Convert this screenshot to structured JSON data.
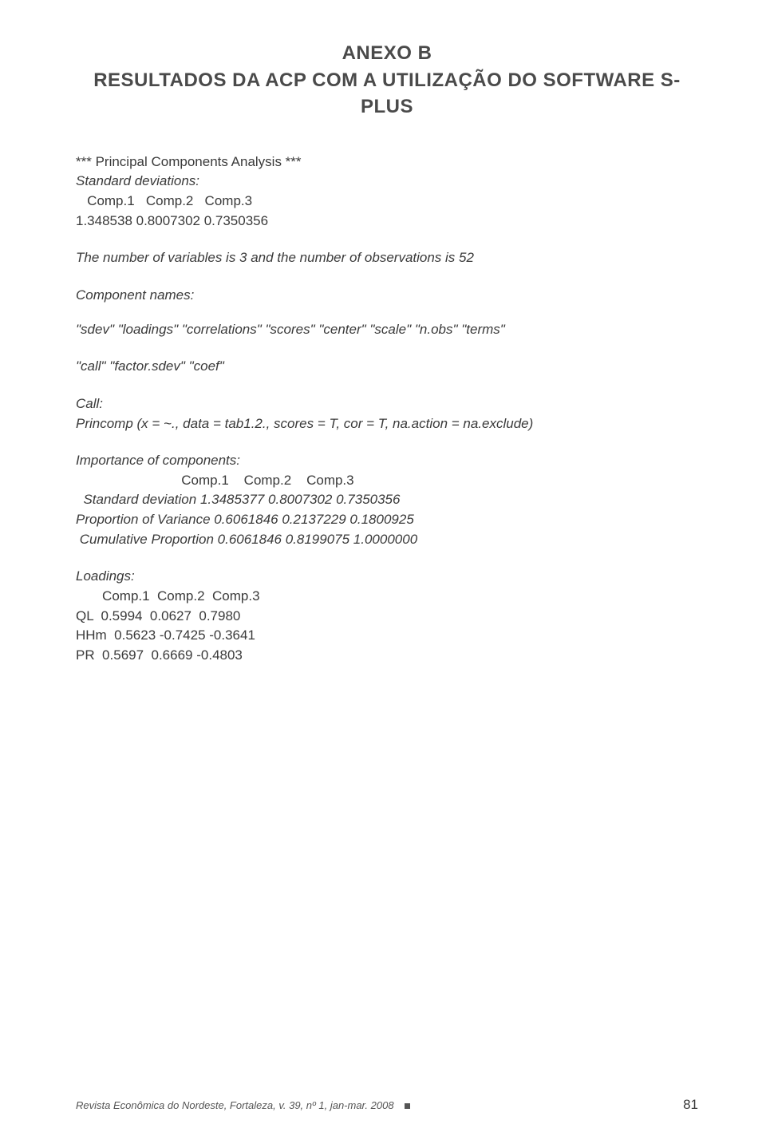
{
  "title": {
    "line1": "ANEXO B",
    "line2": "RESULTADOS DA ACP COM A UTILIZAÇÃO DO SOFTWARE S-PLUS"
  },
  "body": {
    "pca_header": "*** Principal Components Analysis ***",
    "std_dev_label": "Standard deviations:",
    "std_dev_cols": "   Comp.1   Comp.2   Comp.3",
    "std_dev_vals": "1.348538 0.8007302 0.7350356",
    "num_vars": "The number of variables is 3 and the number of observations is 52",
    "comp_names_label": "Component names:",
    "comp_names": "\"sdev\" \"loadings\" \"correlations\" \"scores\" \"center\" \"scale\" \"n.obs\" \"terms\"",
    "comp_names2": "\"call\" \"factor.sdev\" \"coef\"",
    "call_label": "Call:",
    "call_line": "Princomp (x =  ~., data = tab1.2., scores = T, cor = T, na.action = na.exclude)",
    "importance_label": "Importance of components:",
    "importance_cols": "                            Comp.1    Comp.2    Comp.3",
    "std_dev_row": "  Standard deviation 1.3485377 0.8007302 0.7350356",
    "prop_var_row": "Proportion of Variance 0.6061846 0.2137229 0.1800925",
    "cum_prop_row": " Cumulative Proportion 0.6061846 0.8199075 1.0000000",
    "loadings_label": "Loadings:",
    "loadings_cols": "       Comp.1  Comp.2  Comp.3",
    "ql_row": "QL  0.5994  0.0627  0.7980",
    "hhm_row": "HHm  0.5623 -0.7425 -0.3641",
    "pr_row": "PR  0.5697  0.6669 -0.4803"
  },
  "footer": {
    "left": "Revista Econômica do Nordeste, Fortaleza, v. 39, nº 1, jan-mar. 2008",
    "right": "81"
  }
}
